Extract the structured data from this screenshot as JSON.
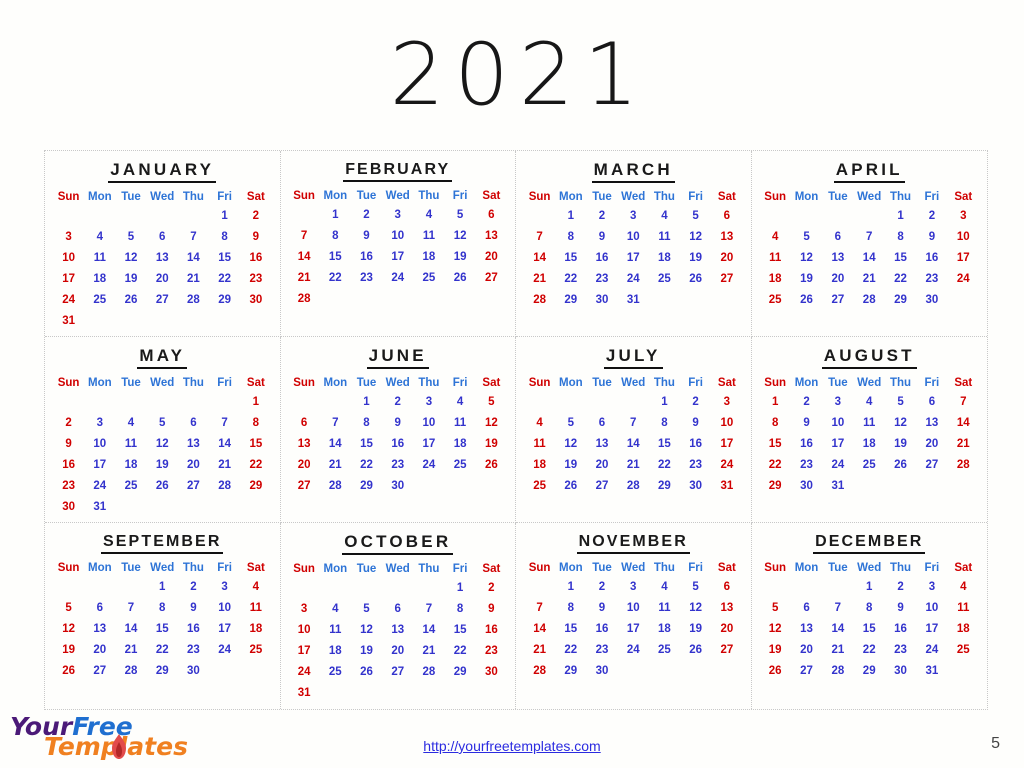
{
  "document": {
    "year_title": "2021",
    "page_number": "5"
  },
  "footer": {
    "url_text": "http://yourfreetemplates.com",
    "logo": {
      "word1": "Your",
      "word2": "Free",
      "word3": "Templates",
      "color_your": "#4b1a78",
      "color_free": "#1f6fd0",
      "color_templates": "#f08020",
      "color_mark": "#e24b4b"
    }
  },
  "theme": {
    "weekend_color": "#d00000",
    "weekday_header_color": "#2e74d6",
    "weekday_number_color": "#3333cc",
    "title_color": "#171717",
    "grid_line_color": "#c8c8c8",
    "background_color": "#fefefc",
    "link_color": "#2b2be0"
  },
  "weekday_headers": [
    "Sun",
    "Mon",
    "Tue",
    "Wed",
    "Thu",
    "Fri",
    "Sat"
  ],
  "calendar": {
    "year": 2021,
    "months": [
      {
        "name": "JANUARY",
        "weeks": [
          [
            "",
            "",
            "",
            "",
            "",
            "1",
            "2"
          ],
          [
            "3",
            "4",
            "5",
            "6",
            "7",
            "8",
            "9"
          ],
          [
            "10",
            "11",
            "12",
            "13",
            "14",
            "15",
            "16"
          ],
          [
            "17",
            "18",
            "19",
            "20",
            "21",
            "22",
            "23"
          ],
          [
            "24",
            "25",
            "26",
            "27",
            "28",
            "29",
            "30"
          ],
          [
            "31",
            "",
            "",
            "",
            "",
            "",
            ""
          ]
        ]
      },
      {
        "name": "FEBRUARY",
        "weeks": [
          [
            "",
            "1",
            "2",
            "3",
            "4",
            "5",
            "6"
          ],
          [
            "7",
            "8",
            "9",
            "10",
            "11",
            "12",
            "13"
          ],
          [
            "14",
            "15",
            "16",
            "17",
            "18",
            "19",
            "20"
          ],
          [
            "21",
            "22",
            "23",
            "24",
            "25",
            "26",
            "27"
          ],
          [
            "28",
            "",
            "",
            "",
            "",
            "",
            ""
          ],
          [
            "",
            "",
            "",
            "",
            "",
            "",
            ""
          ]
        ]
      },
      {
        "name": "MARCH",
        "weeks": [
          [
            "",
            "1",
            "2",
            "3",
            "4",
            "5",
            "6"
          ],
          [
            "7",
            "8",
            "9",
            "10",
            "11",
            "12",
            "13"
          ],
          [
            "14",
            "15",
            "16",
            "17",
            "18",
            "19",
            "20"
          ],
          [
            "21",
            "22",
            "23",
            "24",
            "25",
            "26",
            "27"
          ],
          [
            "28",
            "29",
            "30",
            "31",
            "",
            "",
            ""
          ],
          [
            "",
            "",
            "",
            "",
            "",
            "",
            ""
          ]
        ]
      },
      {
        "name": "APRIL",
        "weeks": [
          [
            "",
            "",
            "",
            "",
            "1",
            "2",
            "3"
          ],
          [
            "4",
            "5",
            "6",
            "7",
            "8",
            "9",
            "10"
          ],
          [
            "11",
            "12",
            "13",
            "14",
            "15",
            "16",
            "17"
          ],
          [
            "18",
            "19",
            "20",
            "21",
            "22",
            "23",
            "24"
          ],
          [
            "25",
            "26",
            "27",
            "28",
            "29",
            "30",
            ""
          ],
          [
            "",
            "",
            "",
            "",
            "",
            "",
            ""
          ]
        ]
      },
      {
        "name": "MAY",
        "weeks": [
          [
            "",
            "",
            "",
            "",
            "",
            "",
            "1"
          ],
          [
            "2",
            "3",
            "4",
            "5",
            "6",
            "7",
            "8"
          ],
          [
            "9",
            "10",
            "11",
            "12",
            "13",
            "14",
            "15"
          ],
          [
            "16",
            "17",
            "18",
            "19",
            "20",
            "21",
            "22"
          ],
          [
            "23",
            "24",
            "25",
            "26",
            "27",
            "28",
            "29"
          ],
          [
            "30",
            "31",
            "",
            "",
            "",
            "",
            ""
          ]
        ]
      },
      {
        "name": "JUNE",
        "weeks": [
          [
            "",
            "",
            "1",
            "2",
            "3",
            "4",
            "5"
          ],
          [
            "6",
            "7",
            "8",
            "9",
            "10",
            "11",
            "12"
          ],
          [
            "13",
            "14",
            "15",
            "16",
            "17",
            "18",
            "19"
          ],
          [
            "20",
            "21",
            "22",
            "23",
            "24",
            "25",
            "26"
          ],
          [
            "27",
            "28",
            "29",
            "30",
            "",
            "",
            ""
          ],
          [
            "",
            "",
            "",
            "",
            "",
            "",
            ""
          ]
        ]
      },
      {
        "name": "JULY",
        "weeks": [
          [
            "",
            "",
            "",
            "",
            "1",
            "2",
            "3"
          ],
          [
            "4",
            "5",
            "6",
            "7",
            "8",
            "9",
            "10"
          ],
          [
            "11",
            "12",
            "13",
            "14",
            "15",
            "16",
            "17"
          ],
          [
            "18",
            "19",
            "20",
            "21",
            "22",
            "23",
            "24"
          ],
          [
            "25",
            "26",
            "27",
            "28",
            "29",
            "30",
            "31"
          ],
          [
            "",
            "",
            "",
            "",
            "",
            "",
            ""
          ]
        ]
      },
      {
        "name": "AUGUST",
        "weeks": [
          [
            "1",
            "2",
            "3",
            "4",
            "5",
            "6",
            "7"
          ],
          [
            "8",
            "9",
            "10",
            "11",
            "12",
            "13",
            "14"
          ],
          [
            "15",
            "16",
            "17",
            "18",
            "19",
            "20",
            "21"
          ],
          [
            "22",
            "23",
            "24",
            "25",
            "26",
            "27",
            "28"
          ],
          [
            "29",
            "30",
            "31",
            "",
            "",
            "",
            ""
          ],
          [
            "",
            "",
            "",
            "",
            "",
            "",
            ""
          ]
        ]
      },
      {
        "name": "SEPTEMBER",
        "weeks": [
          [
            "",
            "",
            "",
            "1",
            "2",
            "3",
            "4"
          ],
          [
            "5",
            "6",
            "7",
            "8",
            "9",
            "10",
            "11"
          ],
          [
            "12",
            "13",
            "14",
            "15",
            "16",
            "17",
            "18"
          ],
          [
            "19",
            "20",
            "21",
            "22",
            "23",
            "24",
            "25"
          ],
          [
            "26",
            "27",
            "28",
            "29",
            "30",
            "",
            ""
          ],
          [
            "",
            "",
            "",
            "",
            "",
            "",
            ""
          ]
        ]
      },
      {
        "name": "OCTOBER",
        "weeks": [
          [
            "",
            "",
            "",
            "",
            "",
            "1",
            "2"
          ],
          [
            "3",
            "4",
            "5",
            "6",
            "7",
            "8",
            "9"
          ],
          [
            "10",
            "11",
            "12",
            "13",
            "14",
            "15",
            "16"
          ],
          [
            "17",
            "18",
            "19",
            "20",
            "21",
            "22",
            "23"
          ],
          [
            "24",
            "25",
            "26",
            "27",
            "28",
            "29",
            "30"
          ],
          [
            "31",
            "",
            "",
            "",
            "",
            "",
            ""
          ]
        ]
      },
      {
        "name": "NOVEMBER",
        "weeks": [
          [
            "",
            "1",
            "2",
            "3",
            "4",
            "5",
            "6"
          ],
          [
            "7",
            "8",
            "9",
            "10",
            "11",
            "12",
            "13"
          ],
          [
            "14",
            "15",
            "16",
            "17",
            "18",
            "19",
            "20"
          ],
          [
            "21",
            "22",
            "23",
            "24",
            "25",
            "26",
            "27"
          ],
          [
            "28",
            "29",
            "30",
            "",
            "",
            "",
            ""
          ],
          [
            "",
            "",
            "",
            "",
            "",
            "",
            ""
          ]
        ]
      },
      {
        "name": "DECEMBER",
        "weeks": [
          [
            "",
            "",
            "",
            "1",
            "2",
            "3",
            "4"
          ],
          [
            "5",
            "6",
            "7",
            "8",
            "9",
            "10",
            "11"
          ],
          [
            "12",
            "13",
            "14",
            "15",
            "16",
            "17",
            "18"
          ],
          [
            "19",
            "20",
            "21",
            "22",
            "23",
            "24",
            "25"
          ],
          [
            "26",
            "27",
            "28",
            "29",
            "30",
            "31",
            ""
          ],
          [
            "",
            "",
            "",
            "",
            "",
            "",
            ""
          ]
        ]
      }
    ]
  }
}
